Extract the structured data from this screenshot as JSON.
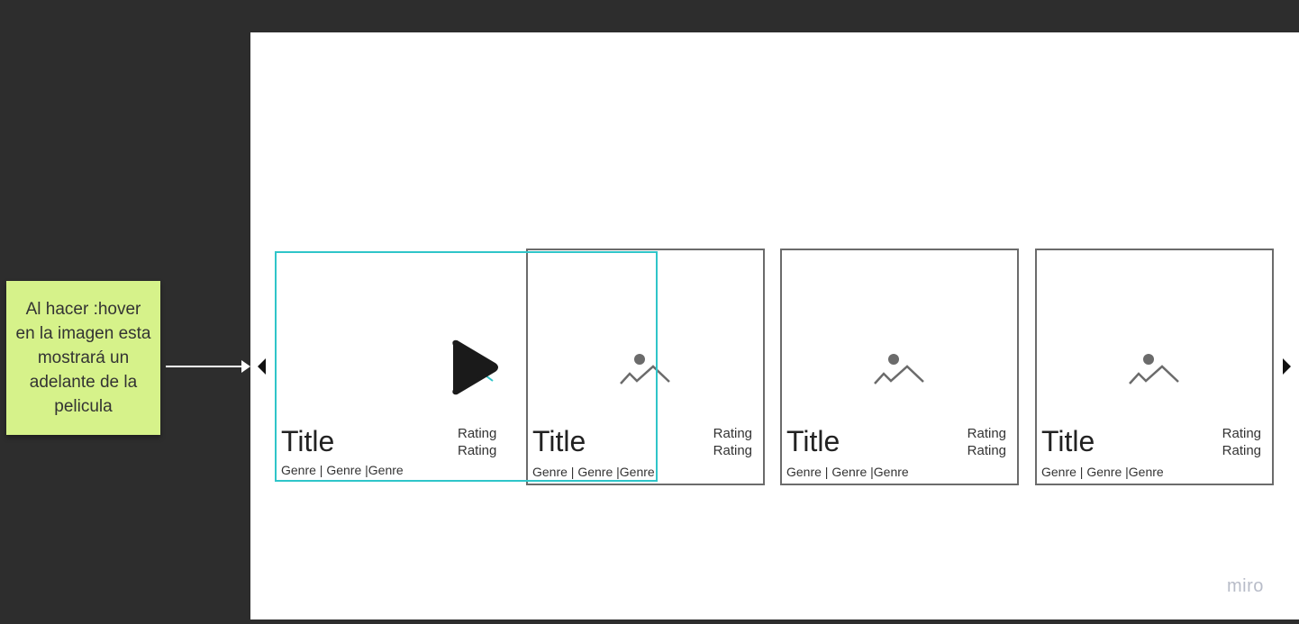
{
  "sticky_note": {
    "text": "Al hacer :hover en la imagen esta mostrará un adelante de la pelicula"
  },
  "cards": [
    {
      "title": "Title",
      "genres": "Genre | Genre |Genre",
      "rating_1": "Rating",
      "rating_2": "Rating",
      "state": "hover",
      "icon": "play-icon"
    },
    {
      "title": "Title",
      "genres": "Genre | Genre |Genre",
      "rating_1": "Rating",
      "rating_2": "Rating",
      "state": "default",
      "icon": "image-placeholder-icon"
    },
    {
      "title": "Title",
      "genres": "Genre | Genre |Genre",
      "rating_1": "Rating",
      "rating_2": "Rating",
      "state": "default",
      "icon": "image-placeholder-icon"
    },
    {
      "title": "Title",
      "genres": "Genre | Genre |Genre",
      "rating_1": "Rating",
      "rating_2": "Rating",
      "state": "default",
      "icon": "image-placeholder-icon"
    }
  ],
  "brand": {
    "logo_text": "miro"
  },
  "colors": {
    "hover_border": "#2fc5c9",
    "card_border": "#6b6b6b",
    "sticky_bg": "#d6f28a",
    "board_bg": "#2d2d2d"
  }
}
